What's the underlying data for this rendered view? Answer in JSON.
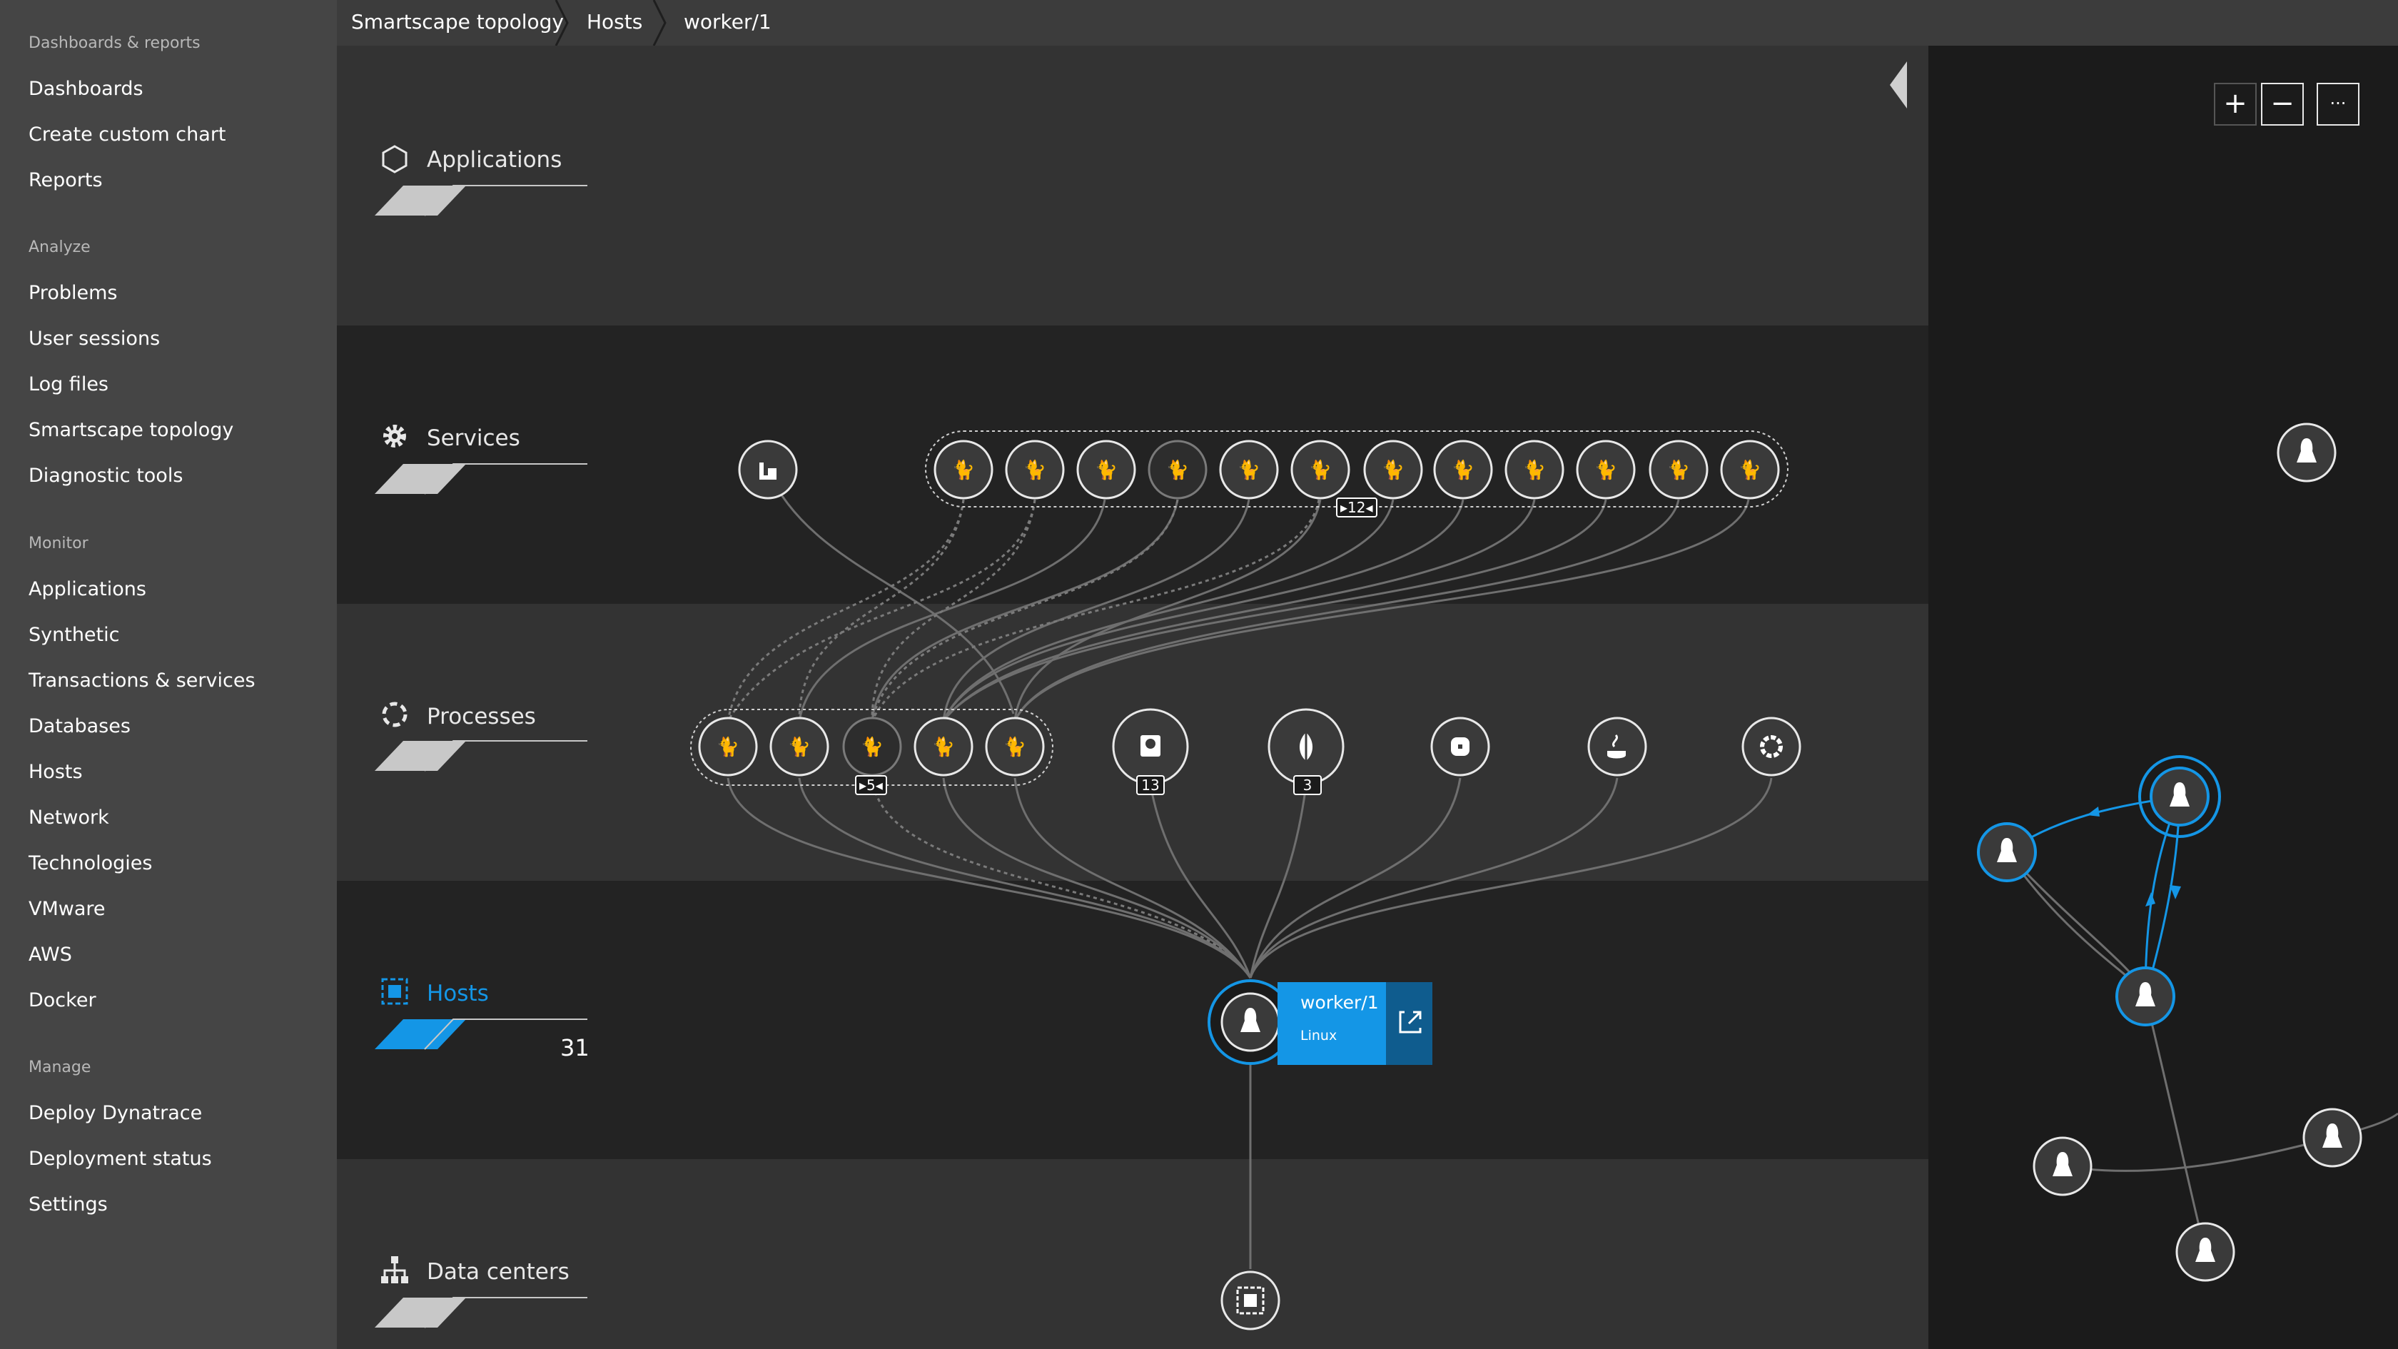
{
  "sidebar": {
    "groups": [
      {
        "title": "Dashboards & reports",
        "items": [
          "Dashboards",
          "Create custom chart",
          "Reports"
        ]
      },
      {
        "title": "Analyze",
        "items": [
          "Problems",
          "User sessions",
          "Log files",
          "Smartscape topology",
          "Diagnostic tools"
        ]
      },
      {
        "title": "Monitor",
        "items": [
          "Applications",
          "Synthetic",
          "Transactions & services",
          "Databases",
          "Hosts",
          "Network",
          "Technologies",
          "VMware",
          "AWS",
          "Docker"
        ]
      },
      {
        "title": "Manage",
        "items": [
          "Deploy Dynatrace",
          "Deployment status",
          "Settings"
        ]
      }
    ]
  },
  "breadcrumb": [
    "Smartscape topology",
    "Hosts",
    "worker/1"
  ],
  "layers": {
    "applications": {
      "label": "Applications"
    },
    "services": {
      "label": "Services",
      "group_badge": "12"
    },
    "processes": {
      "label": "Processes",
      "group_badge": "5",
      "badge_a": "13",
      "badge_b": "3"
    },
    "hosts": {
      "label": "Hosts",
      "count": "31"
    },
    "datacenters": {
      "label": "Data centers"
    }
  },
  "host_card": {
    "name": "worker/1",
    "os": "Linux"
  },
  "map": {
    "zoom_in": "+",
    "zoom_out": "−",
    "more": "···"
  },
  "colors": {
    "accent": "#1496e6",
    "sidebar_bg": "#454545",
    "canvas_light": "#333333",
    "canvas_dark": "#222222"
  }
}
